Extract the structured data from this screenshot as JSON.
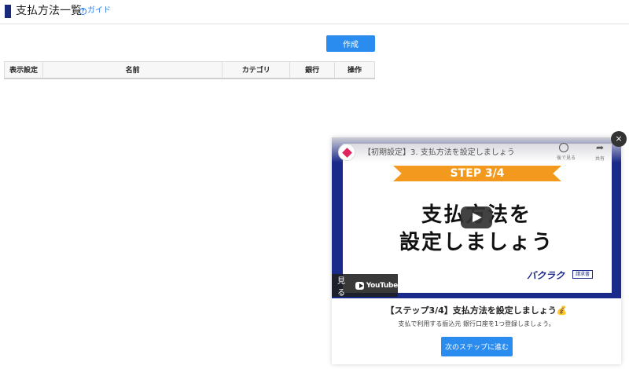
{
  "header": {
    "title": "支払方法一覧",
    "guide_label": "ガイド",
    "guide_icon": "question-circle-icon"
  },
  "toolbar": {
    "create_label": "作成"
  },
  "table": {
    "columns": [
      "表示設定",
      "名前",
      "カテゴリ",
      "銀行",
      "操作"
    ],
    "rows": []
  },
  "popup": {
    "close_label": "×",
    "video": {
      "title": "【初期設定】3. 支払方法を設定しましょう",
      "watch_later_label": "後で見る",
      "share_label": "共有",
      "step_banner": "STEP 3/4",
      "headline_line1": "支払方法を",
      "headline_line2": "設定しましょう",
      "brand": "バクラク",
      "brand_tag": "請求書",
      "watch_on_label": "見る",
      "youtube_label": "YouTube"
    },
    "title": "【ステップ3/4】支払方法を設定しましょう💰",
    "description": "支払で利用する振込元 銀行口座を1つ登録しましょう。",
    "next_label": "次のステップに進む"
  },
  "colors": {
    "accent": "#2b8cf0",
    "title_bar": "#1a2a7a",
    "video_border": "#1a2a8a",
    "step_banner": "#f39a1e"
  }
}
